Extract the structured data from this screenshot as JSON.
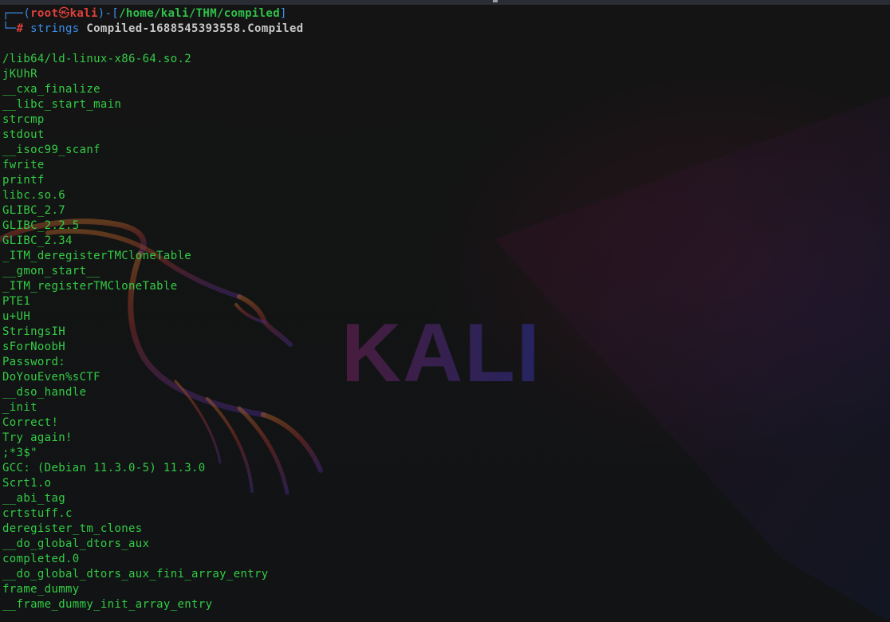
{
  "prompt": {
    "top_prefix": "┌──(",
    "user": "root",
    "at_symbol": "㉿",
    "host": "kali",
    "path_open": ")-[",
    "path": "/home/kali/THM/compiled",
    "path_close": "]",
    "bottom_prefix": "└─",
    "hash": "#",
    "command": "strings",
    "argument": "Compiled-1688545393558.Compiled"
  },
  "output": [
    "/lib64/ld-linux-x86-64.so.2",
    "jKUhR",
    "__cxa_finalize",
    "__libc_start_main",
    "strcmp",
    "stdout",
    "__isoc99_scanf",
    "fwrite",
    "printf",
    "libc.so.6",
    "GLIBC_2.7",
    "GLIBC_2.2.5",
    "GLIBC_2.34",
    "_ITM_deregisterTMCloneTable",
    "__gmon_start__",
    "_ITM_registerTMCloneTable",
    "PTE1",
    "u+UH",
    "StringsIH",
    "sForNoobH",
    "Password: ",
    "DoYouEven%sCTF",
    "__dso_handle",
    "_init",
    "Correct!",
    "Try again!",
    ";*3$\"",
    "GCC: (Debian 11.3.0-5) 11.3.0",
    "Scrt1.o",
    "__abi_tag",
    "crtstuff.c",
    "deregister_tm_clones",
    "__do_global_dtors_aux",
    "completed.0",
    "__do_global_dtors_aux_fini_array_entry",
    "frame_dummy",
    "__frame_dummy_init_array_entry"
  ],
  "wallpaper": {
    "text": "KALI"
  },
  "colors": {
    "background": "#121212",
    "output_text": "#33cc44",
    "prompt_bracket": "#3b8eea",
    "prompt_user": "#e0403c",
    "prompt_path": "#2ec14a",
    "wallpaper_dragon": "#a0522d",
    "wallpaper_text": "#3a1f6e"
  },
  "icons": {
    "wallpaper_logo": "kali-dragon-icon"
  }
}
